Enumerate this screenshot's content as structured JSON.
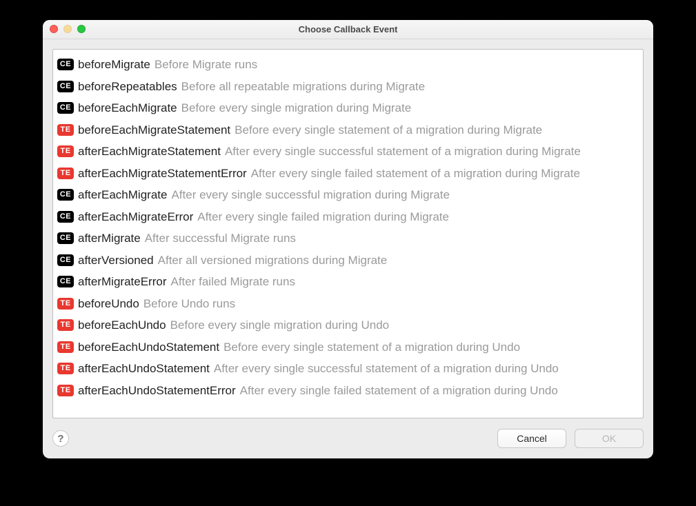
{
  "window": {
    "title": "Choose Callback Event"
  },
  "badges": {
    "ce": "CE",
    "te": "TE"
  },
  "events": [
    {
      "badge": "ce",
      "name": "beforeMigrate",
      "desc": "Before Migrate runs"
    },
    {
      "badge": "ce",
      "name": "beforeRepeatables",
      "desc": "Before all repeatable migrations during Migrate"
    },
    {
      "badge": "ce",
      "name": "beforeEachMigrate",
      "desc": "Before every single migration during Migrate"
    },
    {
      "badge": "te",
      "name": "beforeEachMigrateStatement",
      "desc": "Before every single statement of a migration during Migrate"
    },
    {
      "badge": "te",
      "name": "afterEachMigrateStatement",
      "desc": "After every single successful statement of a migration during Migrate"
    },
    {
      "badge": "te",
      "name": "afterEachMigrateStatementError",
      "desc": "After every single failed statement of a migration during Migrate"
    },
    {
      "badge": "ce",
      "name": "afterEachMigrate",
      "desc": "After every single successful migration during Migrate"
    },
    {
      "badge": "ce",
      "name": "afterEachMigrateError",
      "desc": "After every single failed migration during Migrate"
    },
    {
      "badge": "ce",
      "name": "afterMigrate",
      "desc": "After successful Migrate runs"
    },
    {
      "badge": "ce",
      "name": "afterVersioned",
      "desc": "After all versioned migrations during Migrate"
    },
    {
      "badge": "ce",
      "name": "afterMigrateError",
      "desc": "After failed Migrate runs"
    },
    {
      "badge": "te",
      "name": "beforeUndo",
      "desc": "Before Undo runs"
    },
    {
      "badge": "te",
      "name": "beforeEachUndo",
      "desc": "Before every single migration during Undo"
    },
    {
      "badge": "te",
      "name": "beforeEachUndoStatement",
      "desc": "Before every single statement of a migration during Undo"
    },
    {
      "badge": "te",
      "name": "afterEachUndoStatement",
      "desc": "After every single successful statement of a migration during Undo"
    },
    {
      "badge": "te",
      "name": "afterEachUndoStatementError",
      "desc": "After every single failed statement of a migration during Undo"
    }
  ],
  "footer": {
    "help": "?",
    "cancel": "Cancel",
    "ok": "OK"
  }
}
